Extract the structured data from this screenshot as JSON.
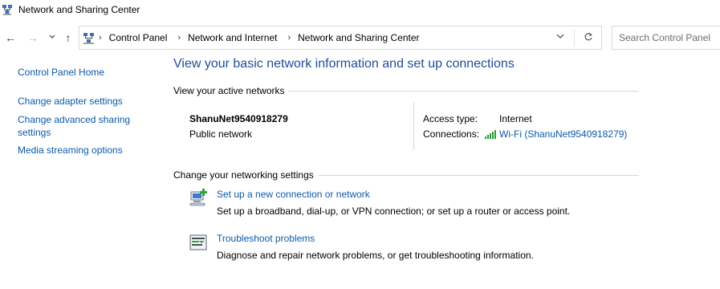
{
  "window": {
    "title": "Network and Sharing Center"
  },
  "nav": {
    "back_label": "←",
    "forward_label": "→",
    "recent_label": "⌄",
    "up_label": "↑"
  },
  "address": {
    "crumbs": [
      "Control Panel",
      "Network and Internet",
      "Network and Sharing Center"
    ],
    "dropdown_icon": "chevron-down-icon",
    "refresh_icon": "refresh-icon"
  },
  "search": {
    "placeholder": "Search Control Panel",
    "value": ""
  },
  "sidebar": {
    "home": "Control Panel Home",
    "items": [
      {
        "label": "Change adapter settings"
      },
      {
        "label": "Change advanced sharing settings"
      },
      {
        "label": "Media streaming options"
      }
    ]
  },
  "main": {
    "heading": "View your basic network information and set up connections",
    "active_section": "View your active networks",
    "network": {
      "name": "ShanuNet9540918279",
      "type": "Public network",
      "access_type_label": "Access type:",
      "access_type_value": "Internet",
      "connections_label": "Connections:",
      "connection_link": "Wi-Fi (ShanuNet9540918279)"
    },
    "settings_section": "Change your networking settings",
    "tasks": [
      {
        "title": "Set up a new connection or network",
        "description": "Set up a broadband, dial-up, or VPN connection; or set up a router or access point.",
        "icon": "new-connection-icon"
      },
      {
        "title": "Troubleshoot problems",
        "description": "Diagnose and repair network problems, or get troubleshooting information.",
        "icon": "troubleshoot-icon"
      }
    ]
  },
  "colors": {
    "link": "#0b5aa7",
    "heading": "#1f4c9a",
    "divider": "#d7d7d7"
  }
}
